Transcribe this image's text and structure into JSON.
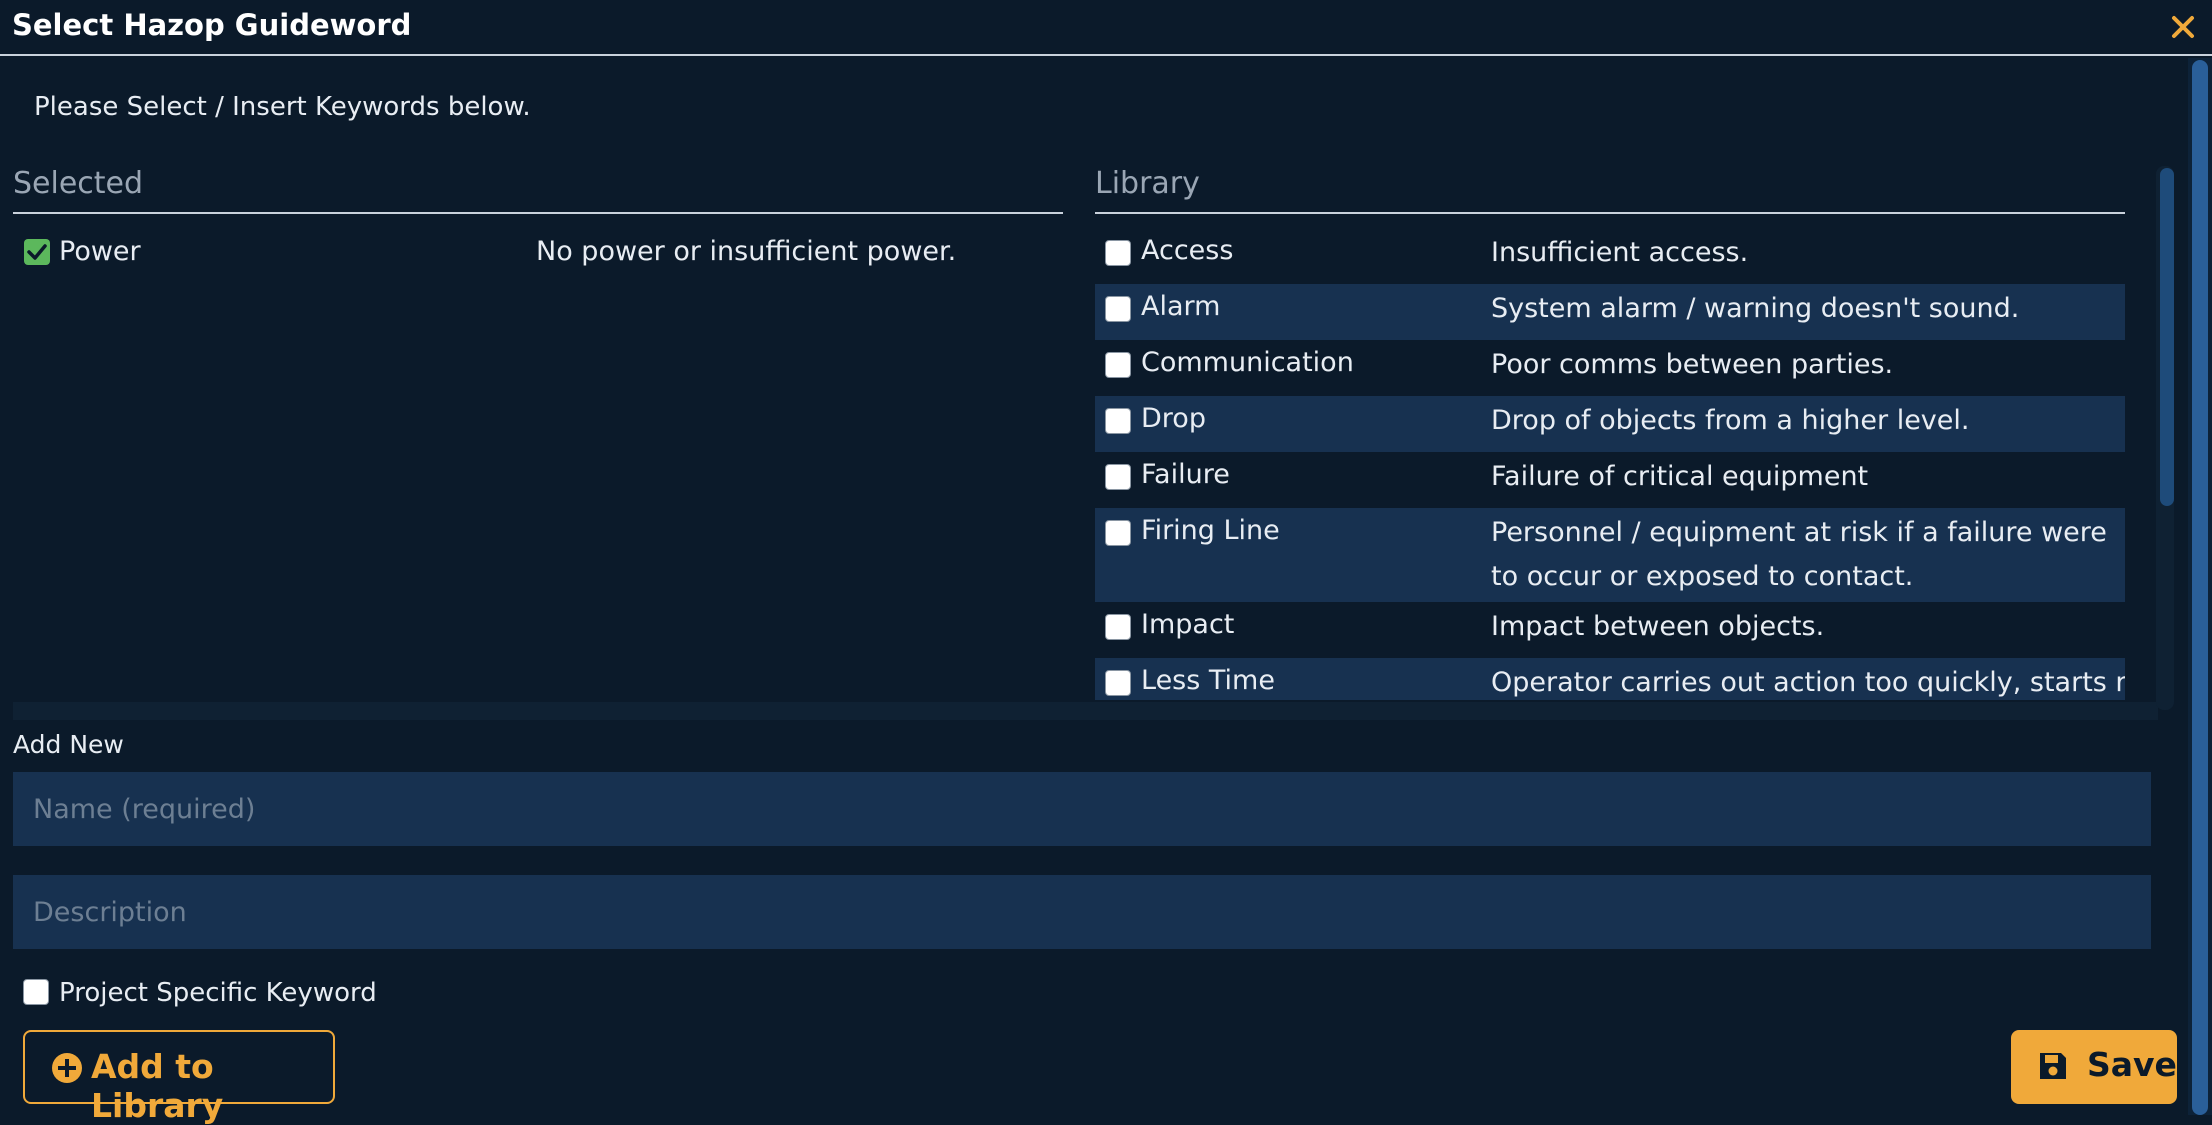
{
  "dialog": {
    "title": "Select Hazop Guideword",
    "instructions": "Please Select / Insert Keywords below."
  },
  "colors": {
    "background": "#0b1a2a",
    "row_alt": "#173150",
    "accent": "#f0a93a",
    "checked": "#5cb85c"
  },
  "selected": {
    "header": "Selected",
    "items": [
      {
        "name": "Power",
        "description": "No power or insufficient power.",
        "checked": true
      }
    ]
  },
  "library": {
    "header": "Library",
    "items": [
      {
        "name": "Access",
        "description": "Insufficient access."
      },
      {
        "name": "Alarm",
        "description": "System alarm / warning doesn't sound."
      },
      {
        "name": "Communication",
        "description": "Poor comms between parties."
      },
      {
        "name": "Drop",
        "description": "Drop of objects from a higher level."
      },
      {
        "name": "Failure",
        "description": "Failure of critical equipment"
      },
      {
        "name": "Firing Line",
        "description": "Personnel / equipment at risk if a failure were to occur or exposed to contact."
      },
      {
        "name": "Impact",
        "description": "Impact between objects."
      },
      {
        "name": "Less Time",
        "description": "Operator carries out action too quickly, starts next"
      }
    ]
  },
  "add_new": {
    "label": "Add New",
    "name_placeholder": "Name (required)",
    "description_placeholder": "Description",
    "project_specific_label": "Project Specific Keyword"
  },
  "buttons": {
    "add_to_library": "Add to Library",
    "save": "Save"
  },
  "icons": {
    "close": "close-icon",
    "add": "plus-circle-icon",
    "save": "floppy-disk-icon"
  }
}
